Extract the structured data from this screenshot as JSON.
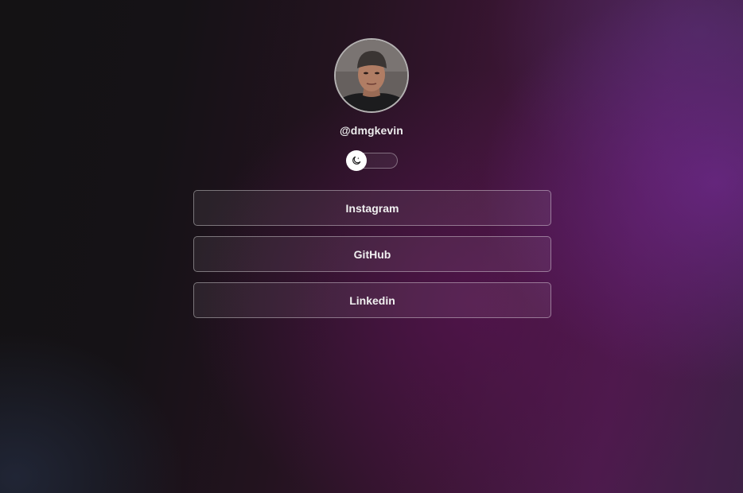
{
  "profile": {
    "handle": "@dmgkevin",
    "avatar_alt": "avatar"
  },
  "theme_toggle": {
    "icon": "moon-icon",
    "state": "dark"
  },
  "links": [
    {
      "label": "Instagram"
    },
    {
      "label": "GitHub"
    },
    {
      "label": "Linkedin"
    }
  ],
  "colors": {
    "background_dark": "#141214",
    "background_accent": "#4c1b4c",
    "button_border": "#8a7a8e",
    "text": "#f0f0f0"
  }
}
